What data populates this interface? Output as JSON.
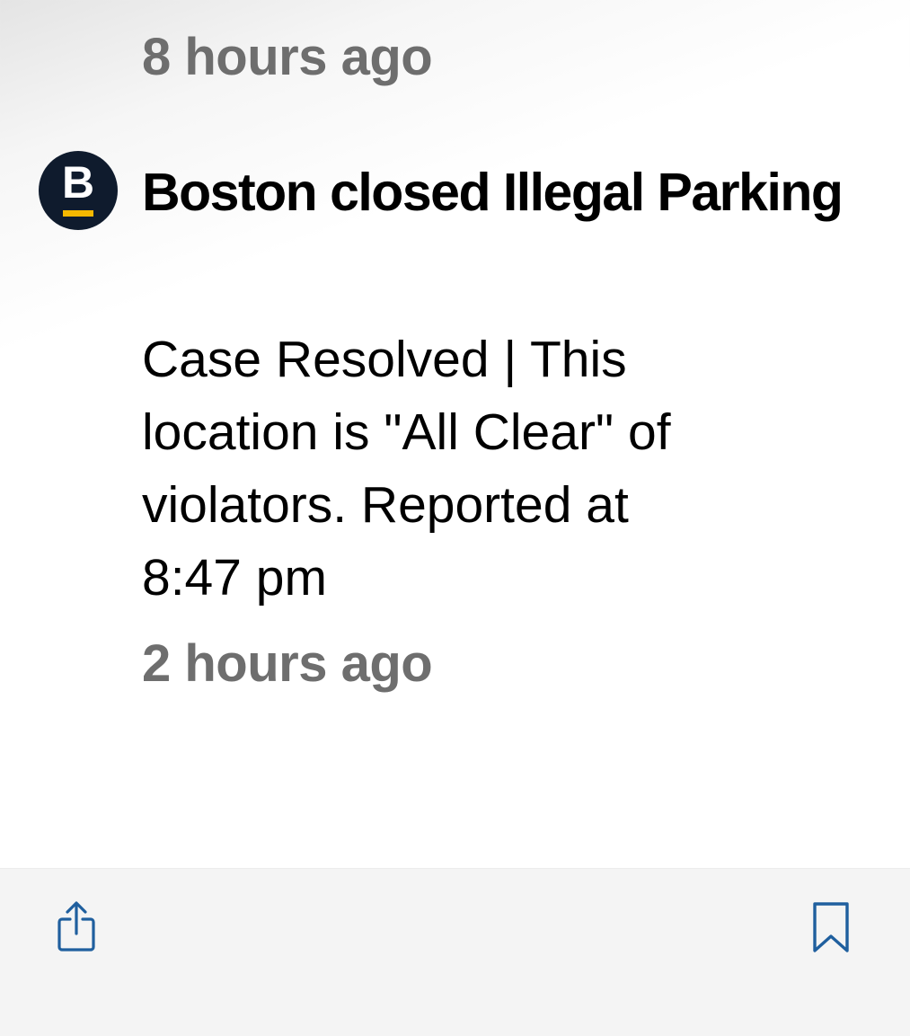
{
  "previous_item": {
    "timestamp": "8 hours ago"
  },
  "item": {
    "source_letter": "B",
    "title": "Boston closed Illegal Parking",
    "body": "Case Resolved | This\nlocation  is \"All Clear\"  of\nviolators.  Reported at\n8:47 pm",
    "timestamp": "2 hours ago"
  },
  "toolbar": {
    "share_icon": "share-icon",
    "bookmark_icon": "bookmark-icon"
  },
  "colors": {
    "accent": "#1f5f9e",
    "avatar_bg": "#0f1b2d",
    "avatar_underline": "#f5b800",
    "timestamp": "#6e6e6e"
  }
}
